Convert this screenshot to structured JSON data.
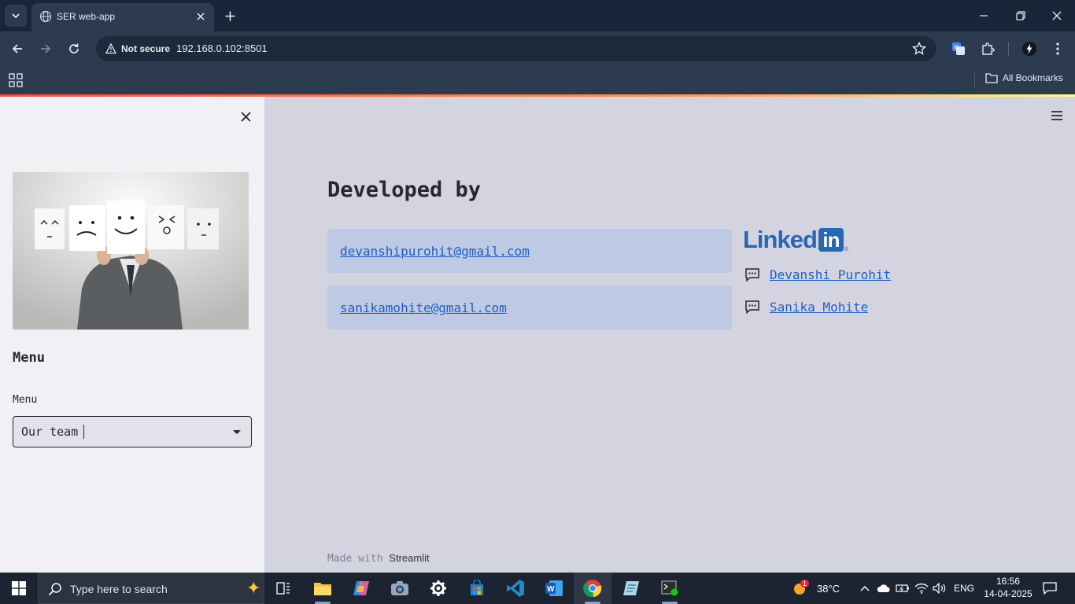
{
  "browser": {
    "tab_title": "SER web-app",
    "security_label": "Not secure",
    "url": "192.168.0.102:8501",
    "bookmarks_label": "All Bookmarks"
  },
  "sidebar": {
    "menu_heading": "Menu",
    "select_label": "Menu",
    "select_value": "Our team"
  },
  "main": {
    "title": "Developed by",
    "emails": [
      "devanshipurohit@gmail.com",
      "sanikamohite@gmail.com"
    ],
    "linkedin_logo_text": "Linked",
    "linkedin_logo_box": "in",
    "contacts": [
      "Devanshi Purohit",
      "Sanika Mohite"
    ],
    "footer_prefix": "Made with",
    "footer_brand": "Streamlit"
  },
  "taskbar": {
    "search_placeholder": "Type here to search",
    "weather_temp": "38°C",
    "weather_badge": "1",
    "language": "ENG",
    "time": "16:56",
    "date": "14-04-2025"
  },
  "colors": {
    "accent_link": "#1f5fc4",
    "linkedin_blue": "#2867b2",
    "card_bg": "#bec9e4",
    "main_bg": "#d4d3e0",
    "sidebar_bg": "#f0f0f5"
  }
}
